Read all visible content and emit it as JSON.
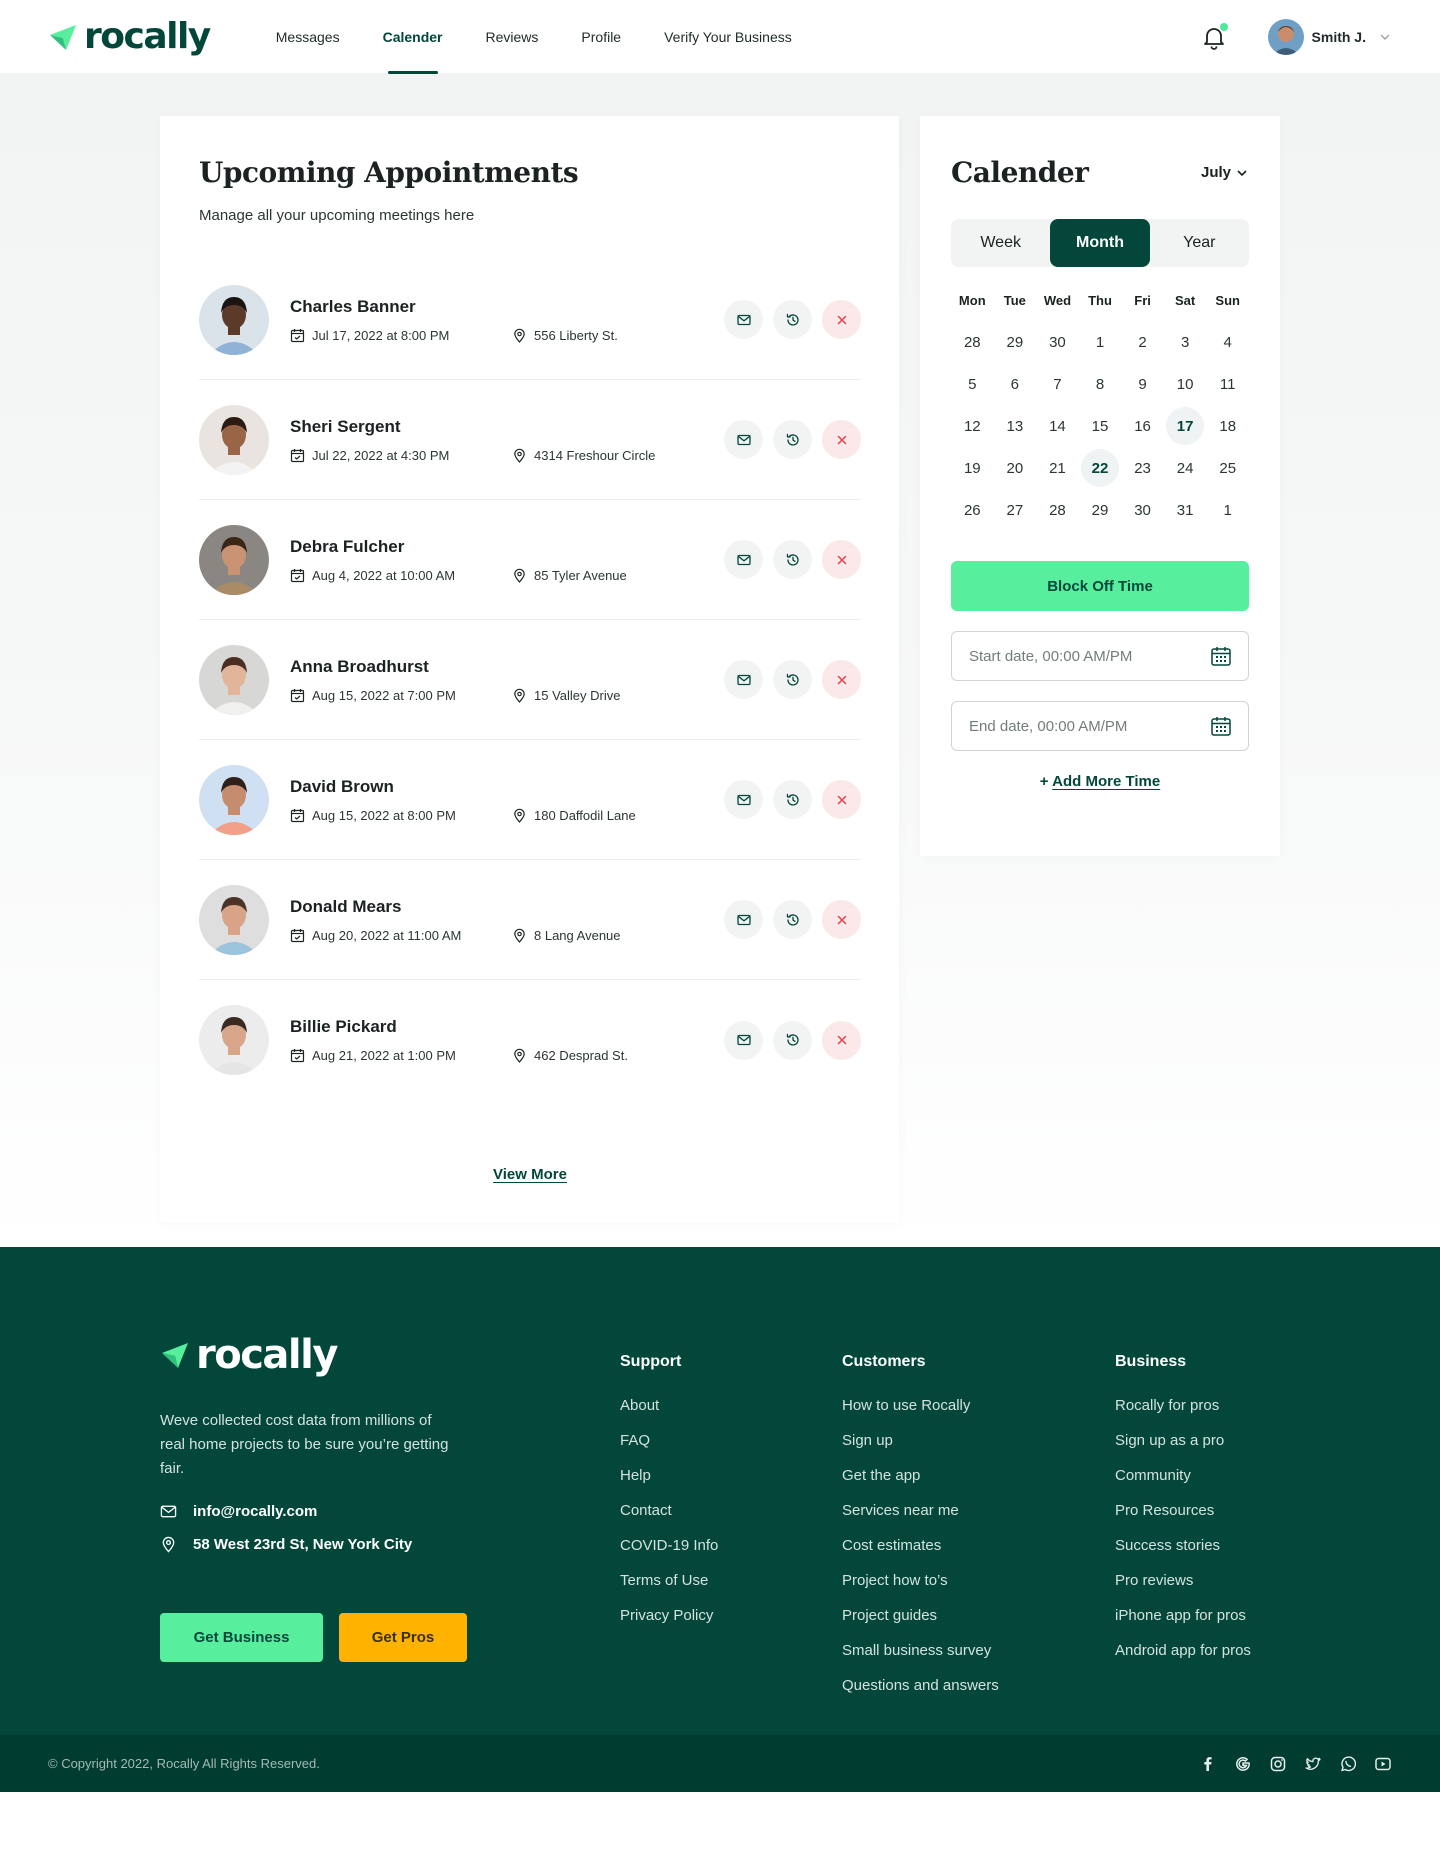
{
  "brand": {
    "name": "rocally"
  },
  "nav": [
    {
      "label": "Messages",
      "active": false
    },
    {
      "label": "Calender",
      "active": true
    },
    {
      "label": "Reviews",
      "active": false
    },
    {
      "label": "Profile",
      "active": false
    },
    {
      "label": "Verify Your Business",
      "active": false
    }
  ],
  "user": {
    "name": "Smith J."
  },
  "appointments": {
    "title": "Upcoming Appointments",
    "subtitle": "Manage all your upcoming meetings here",
    "items": [
      {
        "name": "Charles Banner",
        "datetime": "Jul 17, 2022 at 8:00 PM",
        "location": "556 Liberty St."
      },
      {
        "name": "Sheri Sergent",
        "datetime": "Jul 22, 2022 at 4:30 PM",
        "location": "4314 Freshour Circle"
      },
      {
        "name": "Debra Fulcher",
        "datetime": "Aug 4, 2022 at 10:00 AM",
        "location": "85 Tyler Avenue"
      },
      {
        "name": "Anna Broadhurst",
        "datetime": "Aug 15, 2022 at 7:00 PM",
        "location": "15 Valley Drive"
      },
      {
        "name": "David Brown",
        "datetime": "Aug 15, 2022 at 8:00 PM",
        "location": "180 Daffodil Lane"
      },
      {
        "name": "Donald Mears",
        "datetime": "Aug 20, 2022 at 11:00 AM",
        "location": "8 Lang Avenue"
      },
      {
        "name": "Billie Pickard",
        "datetime": "Aug 21, 2022 at 1:00 PM",
        "location": "462 Desprad St."
      }
    ],
    "view_more": "View More"
  },
  "calendar": {
    "title": "Calender",
    "month": "July",
    "views": [
      {
        "label": "Week",
        "active": false
      },
      {
        "label": "Month",
        "active": true
      },
      {
        "label": "Year",
        "active": false
      }
    ],
    "weekdays": [
      "Mon",
      "Tue",
      "Wed",
      "Thu",
      "Fri",
      "Sat",
      "Sun"
    ],
    "weeks": [
      [
        "28",
        "29",
        "30",
        "1",
        "2",
        "3",
        "4"
      ],
      [
        "5",
        "6",
        "7",
        "8",
        "9",
        "10",
        "11"
      ],
      [
        "12",
        "13",
        "14",
        "15",
        "16",
        "17",
        "18"
      ],
      [
        "19",
        "20",
        "21",
        "22",
        "23",
        "24",
        "25"
      ],
      [
        "26",
        "27",
        "28",
        "29",
        "30",
        "31",
        "1"
      ]
    ],
    "highlighted_days": [
      "17",
      "22"
    ],
    "block_off_label": "Block Off Time",
    "start_placeholder": "Start date, 00:00 AM/PM",
    "end_placeholder": "End date, 00:00 AM/PM",
    "add_more_prefix": "+ ",
    "add_more_label": "Add More Time"
  },
  "footer": {
    "brand": "rocally",
    "description": "Weve collected cost data from millions of real home projects to be sure you’re getting fair.",
    "email": "info@rocally.com",
    "address": "58 West 23rd St, New York City",
    "btn_business": "Get Business",
    "btn_pros": "Get Pros",
    "columns": [
      {
        "title": "Support",
        "links": [
          "About",
          "FAQ",
          "Help",
          "Contact",
          "COVID-19 Info",
          "Terms of Use",
          "Privacy Policy"
        ]
      },
      {
        "title": "Customers",
        "links": [
          "How to use Rocally",
          "Sign up",
          "Get the app",
          "Services near me",
          "Cost estimates",
          "Project how to’s",
          "Project guides",
          "Small business survey",
          "Questions and answers"
        ]
      },
      {
        "title": "Business",
        "links": [
          "Rocally for pros",
          "Sign up as a pro",
          "Community",
          "Pro Resources",
          "Success stories",
          "Pro reviews",
          "iPhone app for pros",
          "Android app for pros"
        ]
      }
    ],
    "copyright": "© Copyright 2022, Rocally All Rights Reserved.",
    "socials": [
      "facebook-icon",
      "google-icon",
      "instagram-icon",
      "twitter-icon",
      "whatsapp-icon",
      "youtube-icon"
    ]
  },
  "colors": {
    "primary": "#02473a",
    "accent": "#57ee9e",
    "yellow": "#ffb300",
    "danger": "#e0474c"
  }
}
